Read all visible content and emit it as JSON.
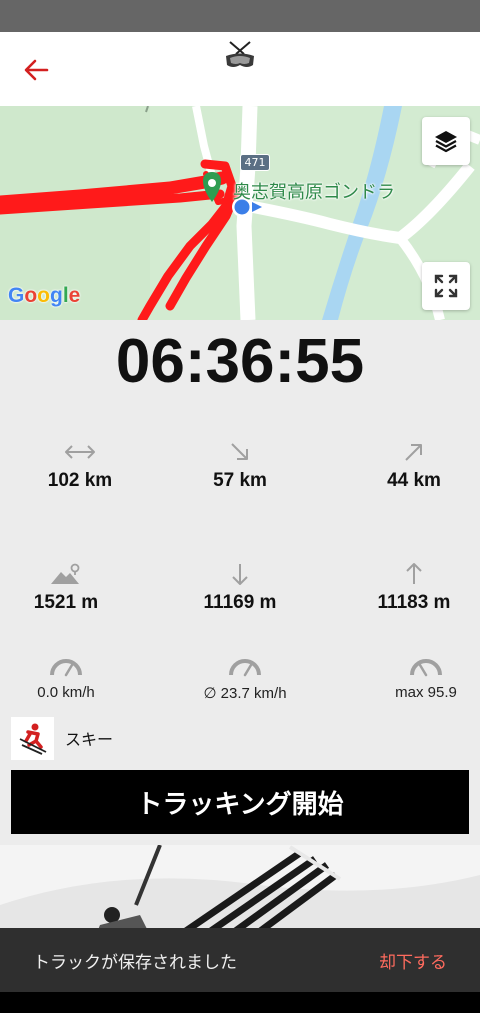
{
  "header": {
    "back_icon": "arrow-left-icon",
    "logo_icon": "skier-goggles-logo-icon",
    "accent_color": "#d32020"
  },
  "map": {
    "place_label": "奥志賀高原ゴンドラ",
    "route_number": "471",
    "attribution": "Google",
    "layers_icon": "layers-icon",
    "fullscreen_icon": "fullscreen-icon",
    "track_color": "#ff1a1a"
  },
  "timer": {
    "elapsed": "06:36:55"
  },
  "stats": {
    "distance": {
      "icon": "horizontal-arrows-icon",
      "value": "102 km"
    },
    "downhill_distance": {
      "icon": "arrow-down-right-icon",
      "value": "57 km"
    },
    "uphill_distance": {
      "icon": "arrow-up-right-icon",
      "value": "44 km"
    },
    "altitude": {
      "icon": "mountain-pin-icon",
      "value": "1521 m"
    },
    "descent": {
      "icon": "arrow-down-icon",
      "value": "11169 m"
    },
    "ascent": {
      "icon": "arrow-up-icon",
      "value": "11183 m"
    },
    "current_speed": {
      "icon": "speedometer-icon",
      "value": "0.0 km/h"
    },
    "avg_speed": {
      "icon": "speedometer-icon",
      "value": "∅ 23.7 km/h"
    },
    "max_speed": {
      "icon": "speedometer-icon",
      "value": "max 95.9"
    }
  },
  "activity": {
    "icon": "skier-icon",
    "label": "スキー"
  },
  "actions": {
    "start_tracking": "トラッキング開始"
  },
  "snackbar": {
    "message": "トラックが保存されました",
    "dismiss": "却下する"
  }
}
